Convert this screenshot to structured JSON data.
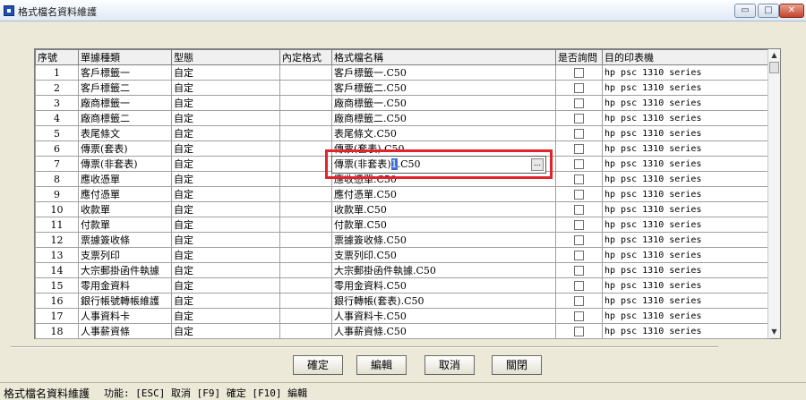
{
  "window": {
    "title": "格式檔名資料維護",
    "minimize": "▭",
    "maximize": "□",
    "close": "✕"
  },
  "grid": {
    "headers": [
      "序號",
      "單據種類",
      "型態",
      "內定格式",
      "格式檔名稱",
      "是否詢問",
      "目的印表機"
    ],
    "rows": [
      [
        "1",
        "客戶標籤一",
        "自定",
        "",
        "客戶標籤一.C50",
        "hp psc 1310 series"
      ],
      [
        "2",
        "客戶標籤二",
        "自定",
        "",
        "客戶標籤二.C50",
        "hp psc 1310 series"
      ],
      [
        "3",
        "廠商標籤一",
        "自定",
        "",
        "廠商標籤一.C50",
        "hp psc 1310 series"
      ],
      [
        "4",
        "廠商標籤二",
        "自定",
        "",
        "廠商標籤二.C50",
        "hp psc 1310 series"
      ],
      [
        "5",
        "表尾條文",
        "自定",
        "",
        "表尾條文.C50",
        "hp psc 1310 series"
      ],
      [
        "6",
        "傳票(套表)",
        "自定",
        "",
        "傳票(套表).C50",
        "hp psc 1310 series"
      ],
      [
        "7",
        "傳票(非套表)",
        "自定",
        "",
        "",
        "hp psc 1310 series"
      ],
      [
        "8",
        "應收憑單",
        "自定",
        "",
        "應收憑單.C50",
        "hp psc 1310 series"
      ],
      [
        "9",
        "應付憑單",
        "自定",
        "",
        "應付憑單.C50",
        "hp psc 1310 series"
      ],
      [
        "10",
        "收款單",
        "自定",
        "",
        "收款單.C50",
        "hp psc 1310 series"
      ],
      [
        "11",
        "付款單",
        "自定",
        "",
        "付款單.C50",
        "hp psc 1310 series"
      ],
      [
        "12",
        "票據簽收條",
        "自定",
        "",
        "票據簽收條.C50",
        "hp psc 1310 series"
      ],
      [
        "13",
        "支票列印",
        "自定",
        "",
        "支票列印.C50",
        "hp psc 1310 series"
      ],
      [
        "14",
        "大宗郵掛函件執據",
        "自定",
        "",
        "大宗郵掛函件執據.C50",
        "hp psc 1310 series"
      ],
      [
        "15",
        "零用金資料",
        "自定",
        "",
        "零用金資料.C50",
        "hp psc 1310 series"
      ],
      [
        "16",
        "銀行帳號轉帳維護",
        "自定",
        "",
        "銀行轉帳(套表).C50",
        "hp psc 1310 series"
      ],
      [
        "17",
        "人事資料卡",
        "自定",
        "",
        "人事資料卡.C50",
        "hp psc 1310 series"
      ],
      [
        "18",
        "人事薪資條",
        "自定",
        "",
        "人事薪資條.C50",
        "hp psc 1310 series"
      ]
    ]
  },
  "editor": {
    "before": "傳票(非套表)",
    "caret": "1",
    "after": ".C50",
    "button": "…"
  },
  "scrollbar": {
    "up": "▲",
    "down": "▼"
  },
  "buttons": {
    "confirm": "確定",
    "edit": "編輯",
    "cancel": "取消",
    "close": "關閉"
  },
  "status": {
    "title": "格式檔名資料維護",
    "keys": "功能: [ESC] 取消  [F9] 確定  [F10] 編輯"
  },
  "colors": {
    "highlight": "#e3232c",
    "caret": "#3a6fd8"
  }
}
